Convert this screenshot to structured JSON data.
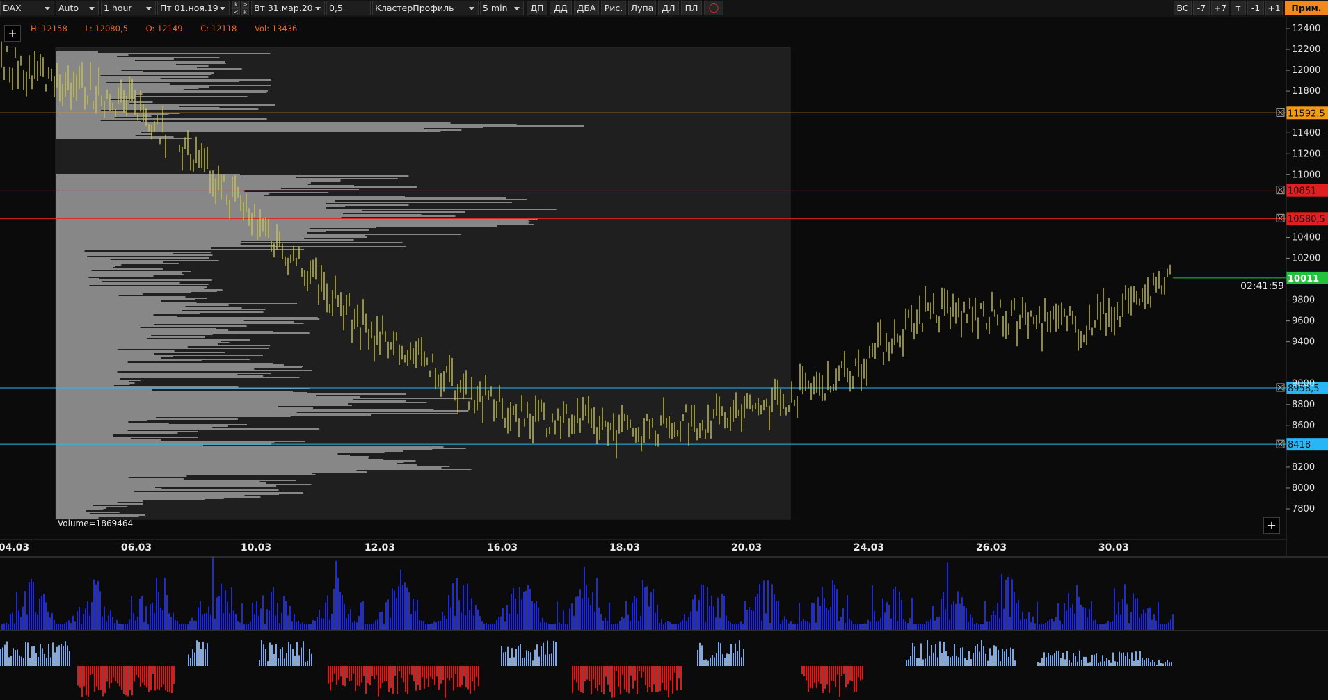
{
  "toolbar": {
    "symbol": "DAX",
    "scale": "Auto",
    "interval": "1 hour",
    "date_from": "Пт 01.ноя.19",
    "date_to": "Вт 31.мар.20",
    "step": "0,5",
    "chart_style": "КластерПрофиль",
    "profile_interval": "5 min",
    "buttons": [
      "ДП",
      "ДД",
      "ДБА",
      "Рис.",
      "Лупа",
      "ДЛ",
      "ПЛ"
    ],
    "right_buttons": [
      "ВС",
      "-7",
      "+7",
      "т",
      "-1",
      "+1"
    ],
    "apply_label": "Прим.",
    "nav_labels": [
      "k",
      ">",
      "<",
      "k"
    ]
  },
  "ohlc": {
    "high": "H: 12158",
    "low": "L: 12080,5",
    "open": "O: 12149",
    "close": "C: 12118",
    "volume": "Vol: 13436"
  },
  "profile_volume_label": "Volume=1869464",
  "timer": "02:41:59",
  "plus_label": "+",
  "price_axis": {
    "ticks": [
      "12400",
      "12200",
      "12000",
      "11800",
      "11400",
      "11200",
      "11000",
      "10400",
      "10200",
      "9800",
      "9600",
      "9400",
      "9000",
      "8800",
      "8600",
      "8200",
      "8000",
      "7800"
    ]
  },
  "levels": [
    {
      "price": "11592,5",
      "value": 11592.5,
      "color": "#f39c12"
    },
    {
      "price": "10851",
      "value": 10851,
      "color": "#e02020"
    },
    {
      "price": "10580,5",
      "value": 10580.5,
      "color": "#e02020"
    },
    {
      "price": "8958,5",
      "value": 8958.5,
      "color": "#29b6f6"
    },
    {
      "price": "8418",
      "value": 8418,
      "color": "#29b6f6"
    }
  ],
  "last_price": {
    "price": "10011",
    "value": 10011,
    "color": "#22c33a"
  },
  "time_axis": {
    "labels": [
      "04.03",
      "06.03",
      "10.03",
      "12.03",
      "16.03",
      "18.03",
      "20.03",
      "24.03",
      "26.03",
      "30.03"
    ]
  },
  "colors": {
    "bars": "#c9c34a",
    "profile": "#9a9a9a",
    "volume": "#1f2bd6",
    "delta_pos": "#7fa8e6",
    "delta_neg": "#e01818"
  },
  "chart_data": {
    "type": "line",
    "title": "",
    "xlabel": "",
    "ylabel": "",
    "ylim": [
      7800,
      12400
    ],
    "x": [
      "04.03",
      "06.03",
      "10.03",
      "12.03",
      "16.03",
      "18.03",
      "20.03",
      "24.03",
      "26.03",
      "30.03",
      "31.03"
    ],
    "series": [
      {
        "values": [
          12100,
          11650,
          10750,
          9550,
          8750,
          8550,
          8700,
          9100,
          9700,
          9550,
          10011
        ]
      }
    ]
  }
}
